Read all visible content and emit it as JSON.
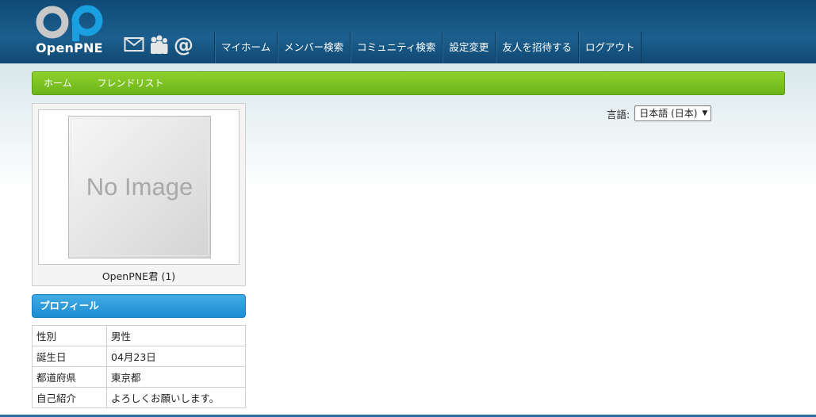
{
  "header": {
    "logo_text": "OpenPNE",
    "icons": [
      "mail-icon",
      "friends-icon",
      "at-icon"
    ],
    "nav": [
      {
        "label": "マイホーム"
      },
      {
        "label": "メンバー検索"
      },
      {
        "label": "コミュニティ検索"
      },
      {
        "label": "設定変更"
      },
      {
        "label": "友人を招待する"
      },
      {
        "label": "ログアウト"
      }
    ]
  },
  "subnav": {
    "home": "ホーム",
    "friend_list": "フレンドリスト"
  },
  "profile_photo": {
    "placeholder_text": "No Image",
    "member_name": "OpenPNE君 (1)"
  },
  "profile": {
    "title": "プロフィール",
    "rows": [
      {
        "key": "性別",
        "value": "男性"
      },
      {
        "key": "誕生日",
        "value": "04月23日"
      },
      {
        "key": "都道府県",
        "value": "東京都"
      },
      {
        "key": "自己紹介",
        "value": "よろしくお願いします。"
      }
    ]
  },
  "language": {
    "label": "言語:",
    "selected": "日本語 (日本)"
  },
  "colors": {
    "header_bg": "#1c5f8e",
    "subnav_green": "#7cc224",
    "profile_blue": "#2b96d8",
    "logo_blue": "#1aa0e0"
  }
}
